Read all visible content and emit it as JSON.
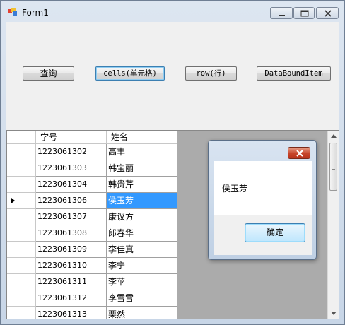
{
  "window": {
    "title": "Form1"
  },
  "buttons": {
    "query": "查询",
    "cells": "cells(单元格)",
    "row": "row(行)",
    "databound": "DataBoundItem"
  },
  "grid": {
    "columns": [
      "学号",
      "姓名"
    ],
    "selected_row": 3,
    "rows": [
      {
        "id": "1223061302",
        "name": "高丰"
      },
      {
        "id": "1223061303",
        "name": "韩宝丽"
      },
      {
        "id": "1223061304",
        "name": "韩贵芹"
      },
      {
        "id": "1223061306",
        "name": "侯玉芳"
      },
      {
        "id": "1223061307",
        "name": "康议方"
      },
      {
        "id": "1223061308",
        "name": "郎春华"
      },
      {
        "id": "1223061309",
        "name": "李佳真"
      },
      {
        "id": "1223061310",
        "name": "李宁"
      },
      {
        "id": "1223061311",
        "name": "李苹"
      },
      {
        "id": "1223061312",
        "name": "李雪雪"
      },
      {
        "id": "1223061313",
        "name": "栗然"
      }
    ]
  },
  "messagebox": {
    "text": "侯玉芳",
    "ok_label": "确定"
  },
  "colors": {
    "selection": "#3399ff",
    "grid_background": "#ababab"
  }
}
